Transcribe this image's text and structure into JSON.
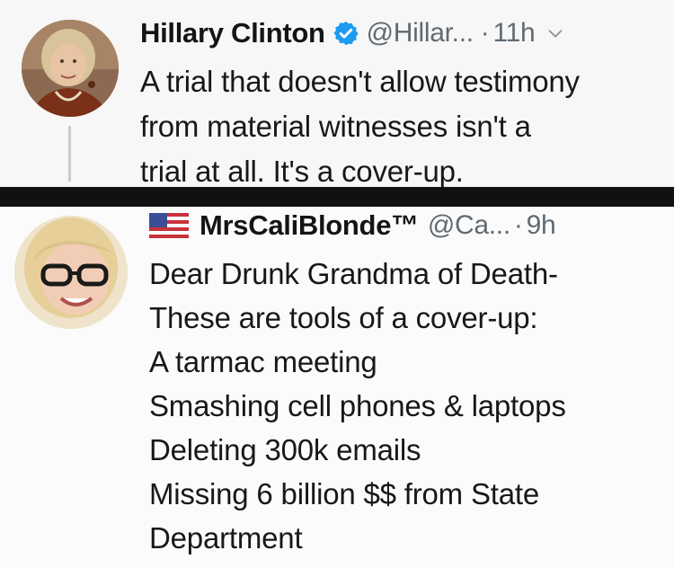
{
  "tweets": [
    {
      "display_name": "Hillary Clinton",
      "handle": "@Hillar...",
      "time": "11h",
      "verified": true,
      "lines": [
        "A trial that doesn't allow testimony",
        "from material witnesses isn't a",
        "trial at all. It's a cover-up."
      ]
    },
    {
      "display_name": "MrsCaliBlonde™",
      "handle": "@Ca...",
      "time": "9h",
      "verified": false,
      "lines": [
        "Dear Drunk Grandma of Death-",
        "These are tools of a cover-up:",
        "A tarmac meeting",
        "Smashing cell phones & laptops",
        "Deleting 300k emails",
        "Missing 6 billion $$ from State",
        "Department"
      ]
    }
  ],
  "separator": "·",
  "colors": {
    "verified": "#1d9bf0",
    "meta_text": "#606a73",
    "divider": "#111111",
    "thread_line": "#c9cdd1"
  },
  "icons": {
    "verified": "verified-badge-icon",
    "more": "chevron-down-icon",
    "flag": "us-flag-icon"
  }
}
